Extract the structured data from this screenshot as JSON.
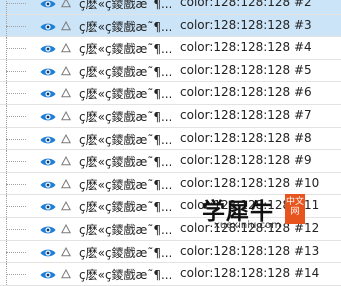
{
  "layers": [
    {
      "name": "ç麽«ç鑁戲æ˜¶...",
      "value": "color:128:128:128 #2",
      "selected": true
    },
    {
      "name": "ç麽«ç鑁戲æ˜¶...",
      "value": "color:128:128:128 #3",
      "selected": true
    },
    {
      "name": "ç麽«ç鑁戲æ˜¶...",
      "value": "color:128:128:128 #4",
      "selected": false
    },
    {
      "name": "ç麽«ç鑁戲æ˜¶...",
      "value": "color:128:128:128 #5",
      "selected": false
    },
    {
      "name": "ç麽«ç鑁戲æ˜¶...",
      "value": "color:128:128:128 #6",
      "selected": false
    },
    {
      "name": "ç麽«ç鑁戲æ˜¶...",
      "value": "color:128:128:128 #7",
      "selected": false
    },
    {
      "name": "ç麽«ç鑁戲æ˜¶...",
      "value": "color:128:128:128 #8",
      "selected": false
    },
    {
      "name": "ç麽«ç鑁戲æ˜¶...",
      "value": "color:128:128:128 #9",
      "selected": false
    },
    {
      "name": "ç麽«ç鑁戲æ˜¶...",
      "value": "color:128:128:128 #10",
      "selected": false
    },
    {
      "name": "ç麽«ç鑁戲æ˜¶...",
      "value": "color:128:128:128 #11",
      "selected": false
    },
    {
      "name": "ç麽«ç鑁戲æ˜¶...",
      "value": "color:128:128:128 #12",
      "selected": false
    },
    {
      "name": "ç麽«ç鑁戲æ˜¶...",
      "value": "color:128:128:128 #13",
      "selected": false
    },
    {
      "name": "ç麽«ç鑁戲æ˜¶...",
      "value": "color:128:128:128 #14",
      "selected": false
    }
  ],
  "icons": {
    "visibility": "eye-icon",
    "type": "triangle-icon"
  },
  "colors": {
    "selection": "#cce4f7",
    "eye": "#1f7fd6",
    "text": "#222222",
    "watermark_badge": "#e8541e"
  },
  "watermark": {
    "chars": "学犀牛",
    "url": "xuexiniu.com",
    "badge": "中文网"
  }
}
